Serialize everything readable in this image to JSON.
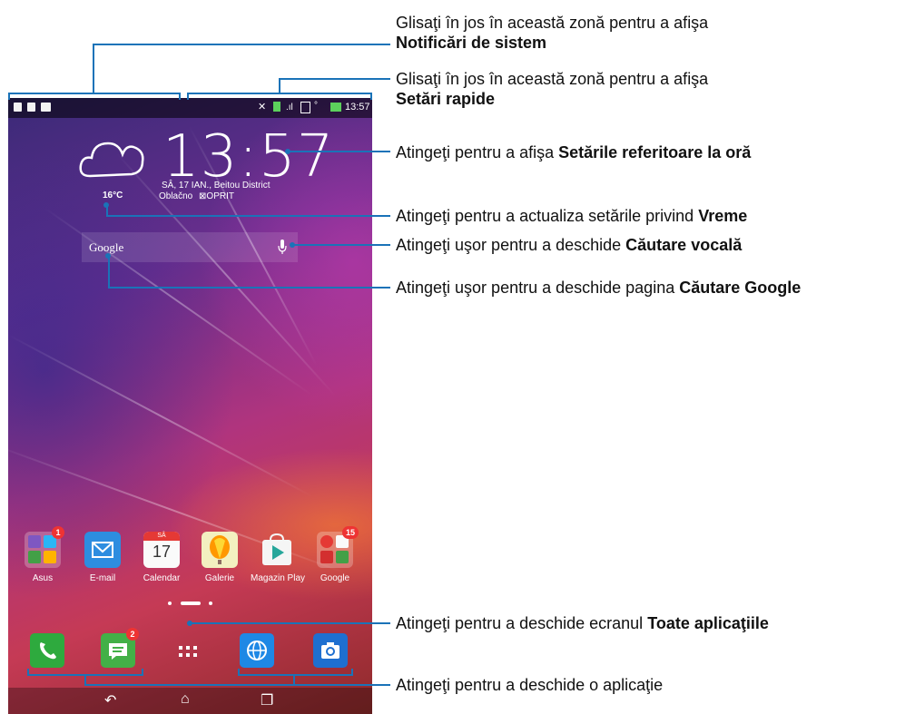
{
  "status_bar": {
    "time": "13:57"
  },
  "clock": {
    "time": "13:57",
    "date": "SÂ, 17 IAN., Beitou District",
    "condition": "Oblačno",
    "alarm": "OPRIT"
  },
  "weather": {
    "temp": "16°C"
  },
  "search": {
    "label": "Google"
  },
  "apps": [
    {
      "label": "Asus",
      "badge": "1"
    },
    {
      "label": "E-mail"
    },
    {
      "label": "Calendar",
      "day_header": "SÂ",
      "day": "17"
    },
    {
      "label": "Galerie"
    },
    {
      "label": "Magazin Play"
    },
    {
      "label": "Google",
      "badge": "15"
    }
  ],
  "dock": {
    "messages_badge": "2"
  },
  "annotations": [
    {
      "text": "Glisaţi în jos în această zonă pentru a afişa ",
      "bold": "Notificări de sistem"
    },
    {
      "text": "Glisaţi în jos în această zonă pentru a afişa ",
      "bold": "Setări rapide"
    },
    {
      "text": "Atingeţi pentru a afişa ",
      "bold": "Setările referitoare la oră"
    },
    {
      "text": "Atingeţi pentru a actualiza setările privind ",
      "bold": "Vreme"
    },
    {
      "text": "Atingeţi uşor pentru a deschide ",
      "bold": "Căutare vocală"
    },
    {
      "text": "Atingeţi uşor pentru a deschide pagina ",
      "bold": "Căutare Google"
    },
    {
      "text": "Atingeţi pentru a deschide ecranul ",
      "bold": "Toate aplicaţiile"
    },
    {
      "text": "Atingeţi pentru a deschide o aplicaţie",
      "bold": ""
    }
  ],
  "colors": {
    "annotation_line": "#1a73b8"
  }
}
